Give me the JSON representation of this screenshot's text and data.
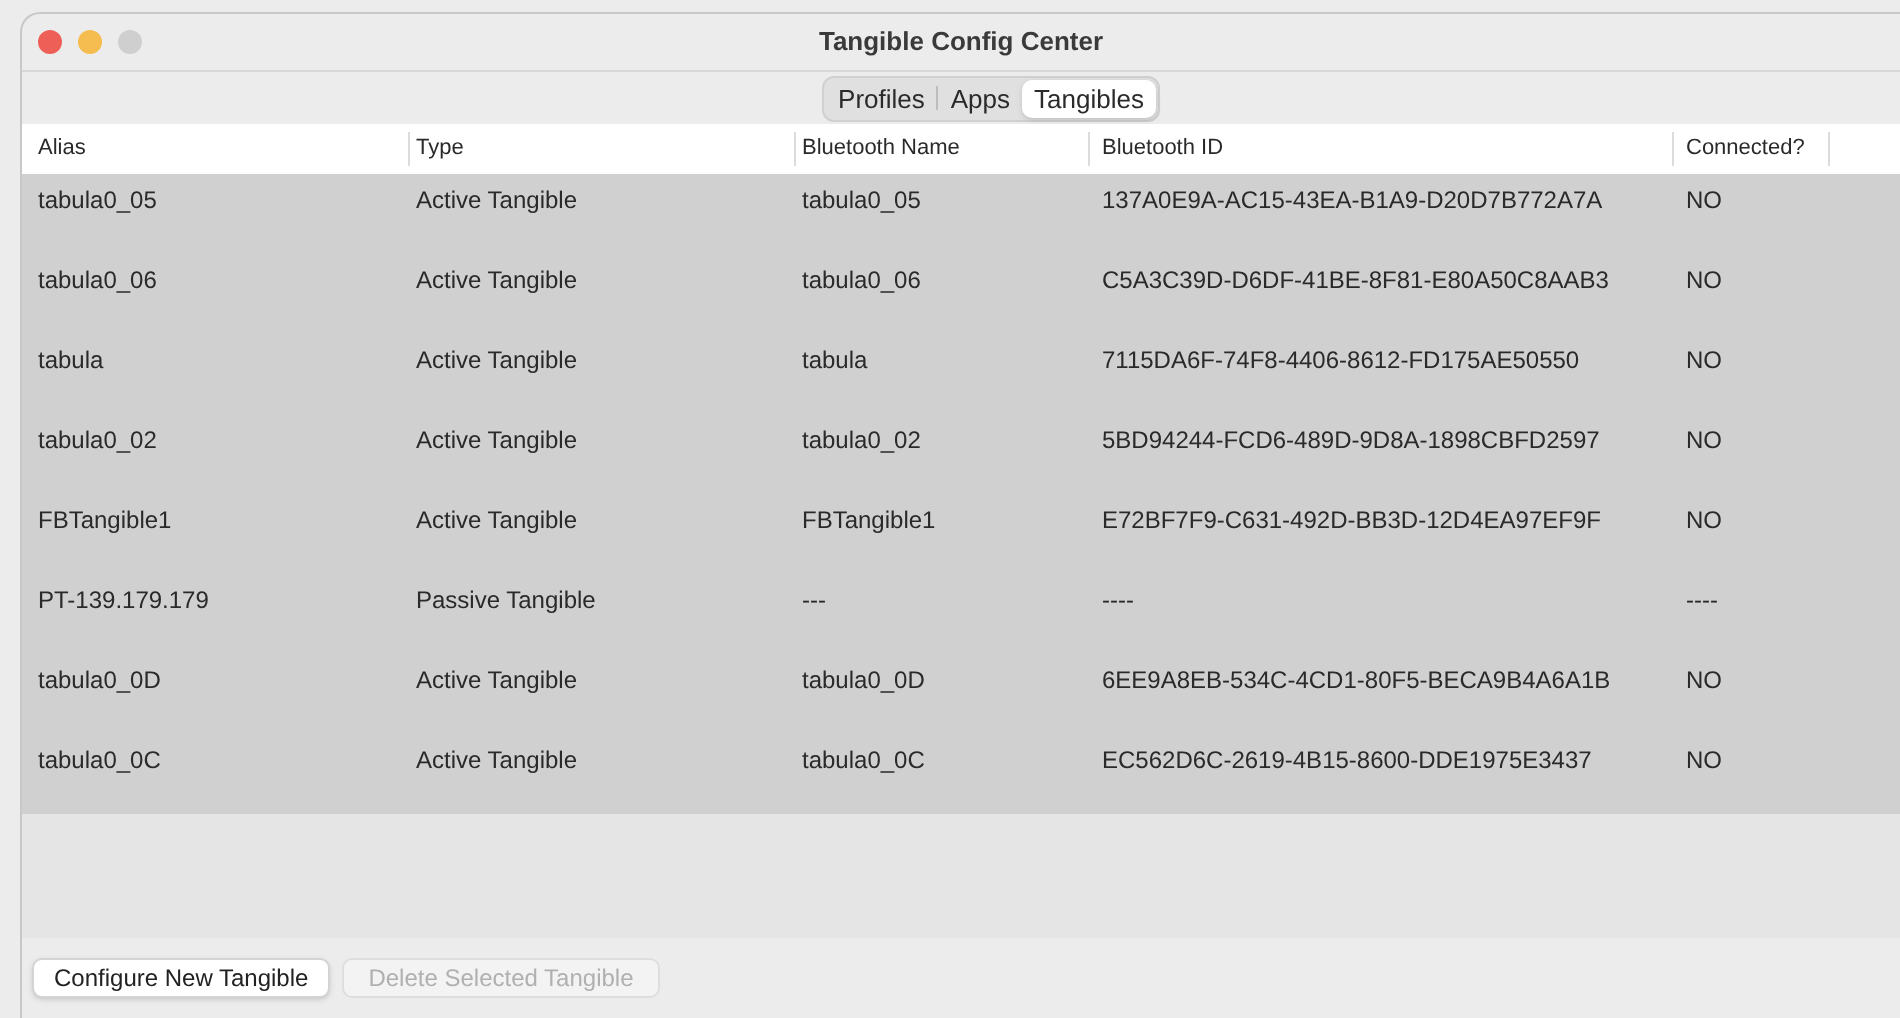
{
  "window": {
    "title": "Tangible Config Center"
  },
  "tabs": [
    {
      "label": "Profiles",
      "selected": false
    },
    {
      "label": "Apps",
      "selected": false
    },
    {
      "label": "Tangibles",
      "selected": true
    }
  ],
  "table": {
    "columns": [
      "Alias",
      "Type",
      "Bluetooth Name",
      "Bluetooth ID",
      "Connected?"
    ],
    "rows": [
      [
        "tabula0_05",
        "Active Tangible",
        "tabula0_05",
        "137A0E9A-AC15-43EA-B1A9-D20D7B772A7A",
        "NO"
      ],
      [
        "tabula0_06",
        "Active Tangible",
        "tabula0_06",
        "C5A3C39D-D6DF-41BE-8F81-E80A50C8AAB3",
        "NO"
      ],
      [
        "tabula",
        "Active Tangible",
        "tabula",
        "7115DA6F-74F8-4406-8612-FD175AE50550",
        "NO"
      ],
      [
        "tabula0_02",
        "Active Tangible",
        "tabula0_02",
        "5BD94244-FCD6-489D-9D8A-1898CBFD2597",
        "NO"
      ],
      [
        "FBTangible1",
        "Active Tangible",
        "FBTangible1",
        "E72BF7F9-C631-492D-BB3D-12D4EA97EF9F",
        "NO"
      ],
      [
        "PT-139.179.179",
        "Passive Tangible",
        "---",
        "----",
        "----"
      ],
      [
        "tabula0_0D",
        "Active Tangible",
        "tabula0_0D",
        "6EE9A8EB-534C-4CD1-80F5-BECA9B4A6A1B",
        "NO"
      ],
      [
        "tabula0_0C",
        "Active Tangible",
        "tabula0_0C",
        "EC562D6C-2619-4B15-8600-DDE1975E3437",
        "NO"
      ]
    ]
  },
  "buttons": [
    {
      "label": "Configure New Tangible",
      "disabled": false
    },
    {
      "label": "Delete Selected Tangible",
      "disabled": true
    }
  ]
}
